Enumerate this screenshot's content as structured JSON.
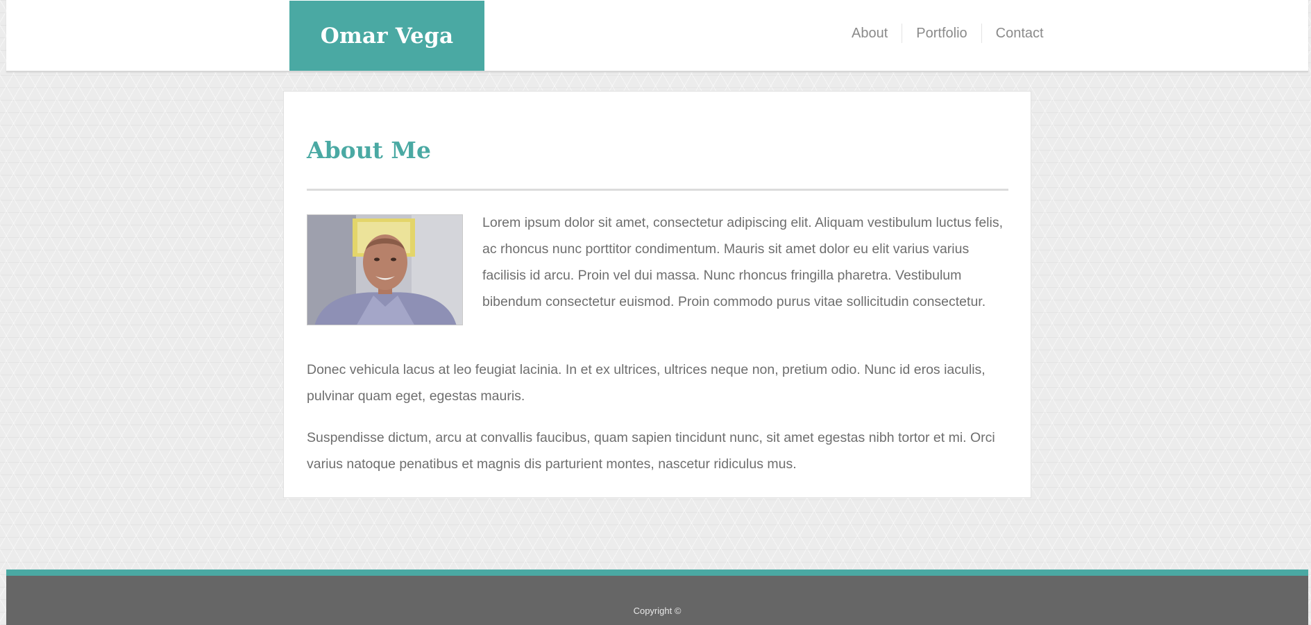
{
  "header": {
    "brand": "Omar Vega",
    "nav": [
      "About",
      "Portfolio",
      "Contact"
    ]
  },
  "main": {
    "title": "About Me",
    "paragraphs": [
      "Lorem ipsum dolor sit amet, consectetur adipiscing elit. Aliquam vestibulum luctus felis, ac rhoncus nunc porttitor condimentum. Mauris sit amet dolor eu elit varius varius facilisis id arcu. Proin vel dui massa. Nunc rhoncus fringilla pharetra. Vestibulum bibendum consectetur euismod. Proin commodo purus vitae sollicitudin consectetur.",
      "Donec vehicula lacus at leo feugiat lacinia. In et ex ultrices, ultrices neque non, pretium odio. Nunc id eros iaculis, pulvinar quam eget, egestas mauris.",
      "Suspendisse dictum, arcu at convallis faucibus, quam sapien tincidunt nunc, sit amet egestas nibh tortor et mi. Orci varius natoque penatibus et magnis dis parturient montes, nascetur ridiculus mus."
    ]
  },
  "footer": {
    "copyright": "Copyright ©"
  },
  "colors": {
    "accent": "#4aa9a3",
    "footer_background": "#666666",
    "body_text": "#6e6e6e",
    "nav_text": "#8a8a8a"
  }
}
